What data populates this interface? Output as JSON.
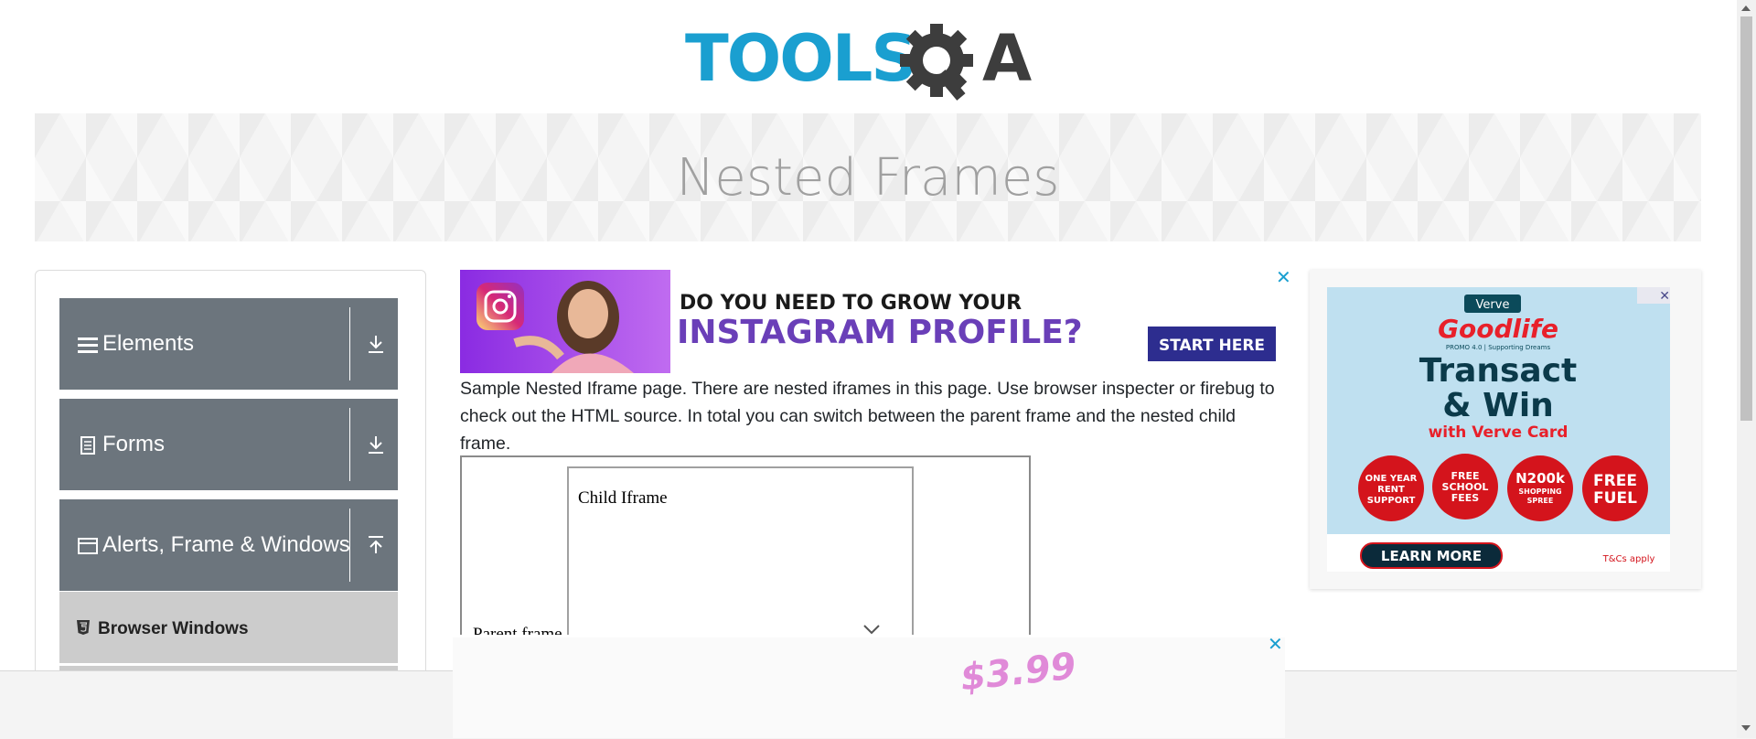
{
  "brand": {
    "logo_text_left": "TOOLS",
    "logo_text_right": "A",
    "primary": "#1a9fd0",
    "dark": "#3d3d3d"
  },
  "banner": {
    "title": "Nested Frames"
  },
  "sidebar": {
    "groups": [
      {
        "label": "Elements",
        "icon": "hamburger-icon",
        "arrow": "download-arrow-icon"
      },
      {
        "label": "Forms",
        "icon": "document-icon",
        "arrow": "download-arrow-icon"
      },
      {
        "label": "Alerts, Frame & Windows",
        "icon": "window-icon",
        "arrow": "upload-arrow-icon"
      }
    ],
    "active_item": {
      "label": "Browser Windows",
      "icon": "html5-icon"
    }
  },
  "ads": {
    "top": {
      "line1": "DO YOU NEED TO GROW YOUR",
      "line2": "INSTAGRAM PROFILE?",
      "cta": "START HERE",
      "close": "✕"
    },
    "side": {
      "brand": "Verve",
      "title": "Goodlife",
      "subtitle": "PROMO 4.0 | Supporting Dreams",
      "headline1": "Transact",
      "headline2": "& Win",
      "tagline": "with Verve Card",
      "circles": [
        {
          "l1": "ONE YEAR",
          "l2": "RENT",
          "l3": "SUPPORT"
        },
        {
          "l1": "FREE",
          "l2": "SCHOOL",
          "l3": "FEES"
        },
        {
          "l1": "N200k",
          "l2": "SHOPPING",
          "l3": "SPREE"
        },
        {
          "l1": "FREE",
          "l2": "FUEL",
          "l3": ""
        }
      ],
      "cta": "LEARN MORE",
      "tc": "T&Cs apply",
      "close": "✕"
    },
    "bottom": {
      "price": "$3.99",
      "close": "✕"
    }
  },
  "content": {
    "intro": "Sample Nested Iframe page. There are nested iframes in this page. Use browser inspecter or firebug to check out the HTML source. In total you can switch between the parent frame and the nested child frame.",
    "parent_label": "Parent frame",
    "child_label": "Child Iframe"
  }
}
